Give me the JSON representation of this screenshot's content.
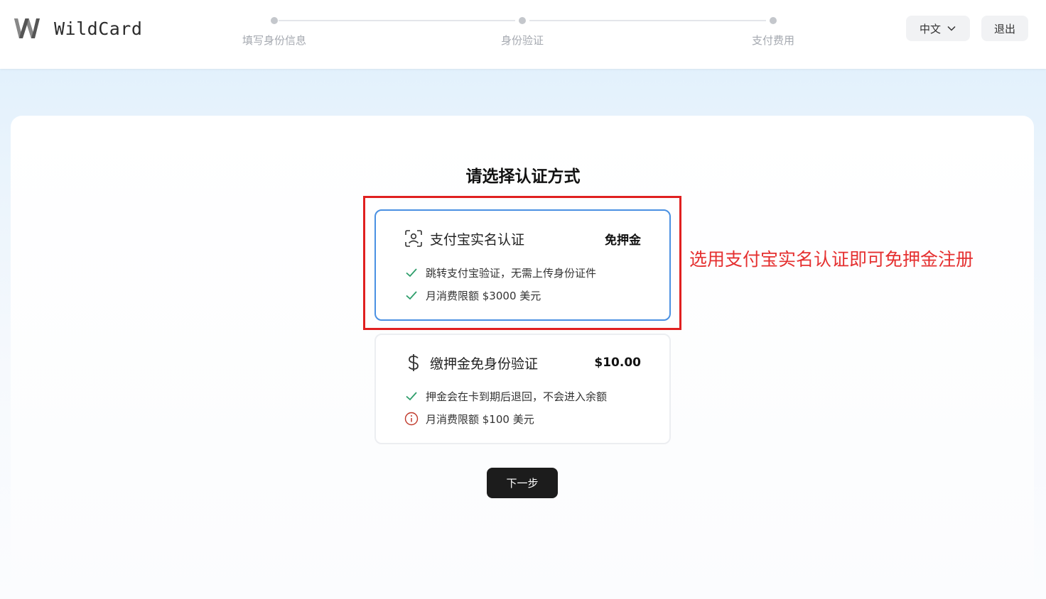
{
  "header": {
    "logo_text": "WildCard",
    "steps": [
      {
        "label": "填写身份信息"
      },
      {
        "label": "身份验证"
      },
      {
        "label": "支付费用"
      }
    ],
    "language_label": "中文",
    "logout_label": "退出"
  },
  "main": {
    "title": "请选择认证方式",
    "options": [
      {
        "title": "支付宝实名认证",
        "badge": "免押金",
        "icon": "face-scan-icon",
        "features": [
          {
            "icon": "check-icon",
            "text": "跳转支付宝验证，无需上传身份证件"
          },
          {
            "icon": "check-icon",
            "text": "月消费限额 $3000 美元"
          }
        ],
        "selected": true
      },
      {
        "title": "缴押金免身份验证",
        "badge": "$10.00",
        "icon": "dollar-icon",
        "features": [
          {
            "icon": "check-icon",
            "text": "押金会在卡到期后退回，不会进入余额"
          },
          {
            "icon": "info-icon",
            "text": "月消费限额 $100 美元"
          }
        ],
        "selected": false
      }
    ],
    "next_label": "下一步"
  },
  "annotation": {
    "text": "选用支付宝实名认证即可免押金注册"
  },
  "colors": {
    "accent": "#4a90e2",
    "check": "#2e9e6b",
    "warning": "#c0392b",
    "annotation": "#e53030",
    "primary_button": "#1c1c1c"
  }
}
